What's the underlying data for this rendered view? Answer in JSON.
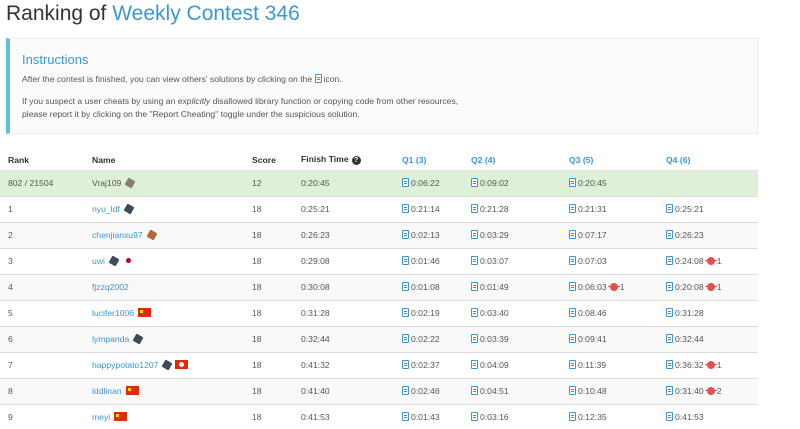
{
  "page": {
    "title_prefix": "Ranking of ",
    "contest_name": "Weekly Contest 346"
  },
  "instructions": {
    "heading": "Instructions",
    "line1_before": "After the contest is finished, you can view others' solutions by clicking on the ",
    "line1_after": "icon.",
    "line2_before": "If you suspect a user cheats by using an ",
    "line2_em": "explicitly",
    "line2_after": " disallowed library function or copying code from other resources,",
    "line3": "please report it by clicking on the \"Report Cheating\" toggle under the suspicious solution."
  },
  "table": {
    "headers": {
      "rank": "Rank",
      "name": "Name",
      "score": "Score",
      "finish_time": "Finish Time",
      "q1": "Q1 (3)",
      "q2": "Q2 (4)",
      "q3": "Q3 (5)",
      "q4": "Q4 (6)"
    },
    "rows": [
      {
        "rank": "802 / 21504",
        "name": "Vraj109",
        "badges": [
          "cube-gray"
        ],
        "score": "12",
        "finish": "0:20:45",
        "q1": "0:06:22",
        "q2": "0:09:02",
        "q3": "0:20:45",
        "q4": "",
        "q4_bugs": "",
        "q3_bugs": ""
      },
      {
        "rank": "1",
        "name": "nyu_ldf",
        "badges": [
          "cube"
        ],
        "score": "18",
        "finish": "0:25:21",
        "q1": "0:21:14",
        "q2": "0:21:28",
        "q3": "0:21:31",
        "q4": "0:25:21",
        "q4_bugs": "",
        "q3_bugs": ""
      },
      {
        "rank": "2",
        "name": "chenjianxu97",
        "badges": [
          "cube-orange"
        ],
        "score": "18",
        "finish": "0:26:23",
        "q1": "0:02:13",
        "q2": "0:03:29",
        "q3": "0:07:17",
        "q4": "0:26:23",
        "q4_bugs": "",
        "q3_bugs": ""
      },
      {
        "rank": "3",
        "name": "uwi",
        "badges": [
          "cube",
          "flag-jp"
        ],
        "score": "18",
        "finish": "0:29:08",
        "q1": "0:01:46",
        "q2": "0:03:07",
        "q3": "0:07:03",
        "q4": "0:24:08",
        "q4_bugs": "1",
        "q3_bugs": ""
      },
      {
        "rank": "4",
        "name": "fjzzq2002",
        "badges": [],
        "score": "18",
        "finish": "0:30:08",
        "q1": "0:01:08",
        "q2": "0:01:49",
        "q3": "0:06:03",
        "q4": "0:20:08",
        "q4_bugs": "1",
        "q3_bugs": "1"
      },
      {
        "rank": "5",
        "name": "lucifer1006",
        "badges": [
          "flag-cn"
        ],
        "score": "18",
        "finish": "0:31:28",
        "q1": "0:02:19",
        "q2": "0:03:40",
        "q3": "0:08:46",
        "q4": "0:31:28",
        "q4_bugs": "",
        "q3_bugs": ""
      },
      {
        "rank": "6",
        "name": "lympanda",
        "badges": [
          "cube"
        ],
        "score": "18",
        "finish": "0:32:44",
        "q1": "0:02:22",
        "q2": "0:03:39",
        "q3": "0:09:41",
        "q4": "0:32:44",
        "q4_bugs": "",
        "q3_bugs": ""
      },
      {
        "rank": "7",
        "name": "happypotato1207",
        "badges": [
          "cube",
          "flag-hk"
        ],
        "score": "18",
        "finish": "0:41:32",
        "q1": "0:02:37",
        "q2": "0:04:09",
        "q3": "0:11:39",
        "q4": "0:36:32",
        "q4_bugs": "1",
        "q3_bugs": ""
      },
      {
        "rank": "8",
        "name": "lddlinan",
        "badges": [
          "flag-cn"
        ],
        "score": "18",
        "finish": "0:41:40",
        "q1": "0:02:46",
        "q2": "0:04:51",
        "q3": "0:10:48",
        "q4": "0:31:40",
        "q4_bugs": "2",
        "q3_bugs": ""
      },
      {
        "rank": "9",
        "name": "meyi",
        "badges": [
          "flag-cn"
        ],
        "score": "18",
        "finish": "0:41:53",
        "q1": "0:01:43",
        "q2": "0:03:16",
        "q3": "0:12:35",
        "q4": "0:41:53",
        "q4_bugs": "",
        "q3_bugs": ""
      }
    ]
  },
  "icons": {
    "solution": "file-code-icon",
    "help": "question-circle-icon",
    "bug": "bug-icon"
  },
  "colors": {
    "accent": "#3a97d4",
    "highlight_row": "#dff0d8",
    "instructions_border": "#5bc0de",
    "bug": "#d9534f"
  }
}
